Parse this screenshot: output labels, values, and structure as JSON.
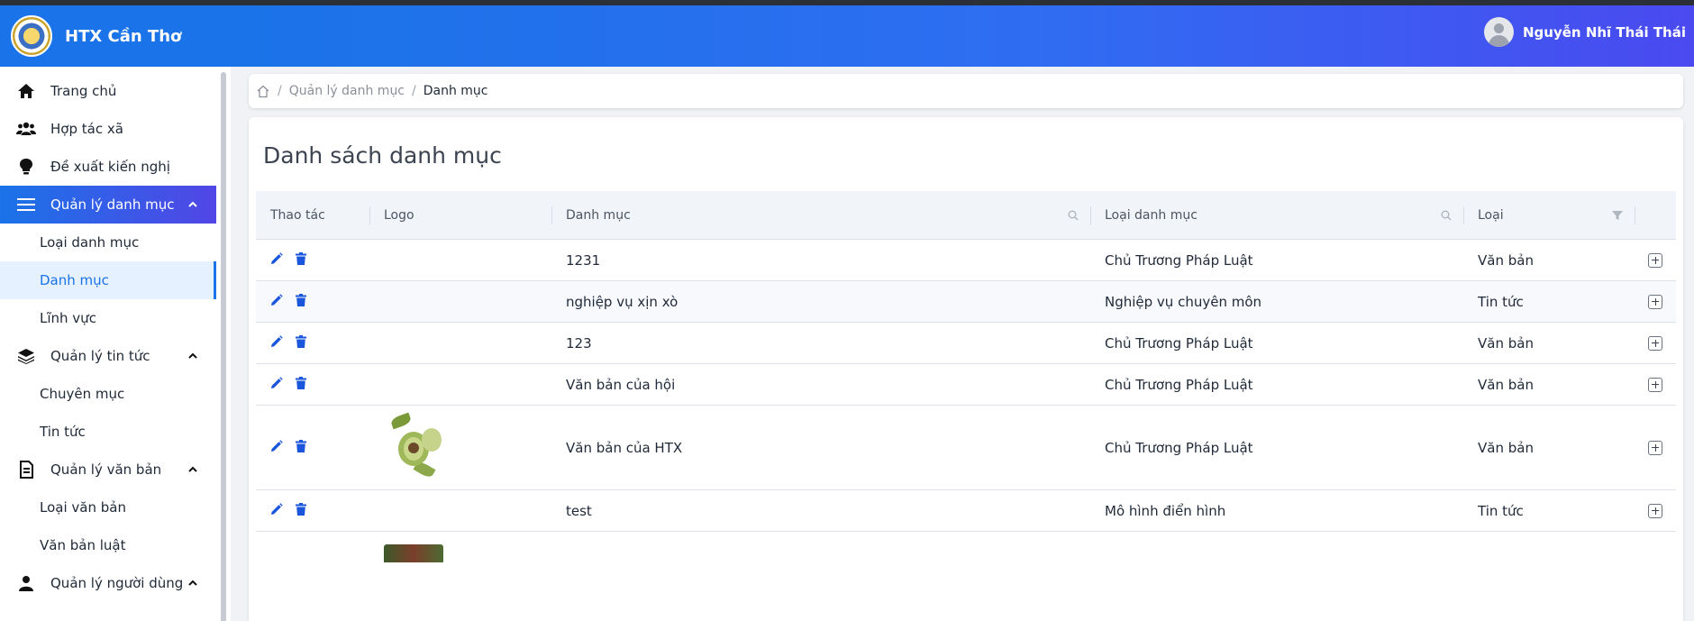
{
  "app": {
    "title": "HTX Cần Thơ"
  },
  "user": {
    "name": "Nguyễn Nhĩ Thái Thái"
  },
  "sidebar": {
    "items": [
      {
        "label": "Trang chủ",
        "icon": "home-icon"
      },
      {
        "label": "Hợp tác xã",
        "icon": "users-icon"
      },
      {
        "label": "Đề xuất kiến nghị",
        "icon": "lightbulb-icon"
      },
      {
        "label": "Quản lý danh mục",
        "icon": "menu-icon",
        "active": true,
        "children": [
          "Loại danh mục",
          "Danh mục",
          "Lĩnh vực"
        ]
      },
      {
        "label": "Quản lý tin tức",
        "icon": "layers-icon",
        "children": [
          "Chuyên mục",
          "Tin tức"
        ]
      },
      {
        "label": "Quản lý văn bản",
        "icon": "document-icon",
        "children": [
          "Loại văn bản",
          "Văn bản luật"
        ]
      },
      {
        "label": "Quản lý người dùng",
        "icon": "user-icon"
      }
    ],
    "selected_child": "Danh mục"
  },
  "breadcrumb": {
    "items": [
      "Quản lý danh mục",
      "Danh mục"
    ]
  },
  "page": {
    "title": "Danh sách danh mục"
  },
  "table": {
    "headers": [
      "Thao tác",
      "Logo",
      "Danh mục",
      "Loại danh mục",
      "Loại"
    ],
    "rows": [
      {
        "danh_muc": "1231",
        "loai_danh_muc": "Chủ Trương Pháp Luật",
        "loai": "Văn bản",
        "has_logo": false
      },
      {
        "danh_muc": "nghiệp vụ xịn xò",
        "loai_danh_muc": "Nghiệp vụ chuyên môn",
        "loai": "Tin tức",
        "has_logo": false
      },
      {
        "danh_muc": "123",
        "loai_danh_muc": "Chủ Trương Pháp Luật",
        "loai": "Văn bản",
        "has_logo": false
      },
      {
        "danh_muc": "Văn bản của hội",
        "loai_danh_muc": "Chủ Trương Pháp Luật",
        "loai": "Văn bản",
        "has_logo": false
      },
      {
        "danh_muc": "Văn bản của HTX",
        "loai_danh_muc": "Chủ Trương Pháp Luật",
        "loai": "Văn bản",
        "has_logo": true
      },
      {
        "danh_muc": "test",
        "loai_danh_muc": "Mô hình điển hình",
        "loai": "Tin tức",
        "has_logo": false
      }
    ]
  },
  "colors": {
    "primary": "#1a73e8",
    "action_icon": "#1a56db",
    "header_gradient_end": "#4a4af0"
  }
}
